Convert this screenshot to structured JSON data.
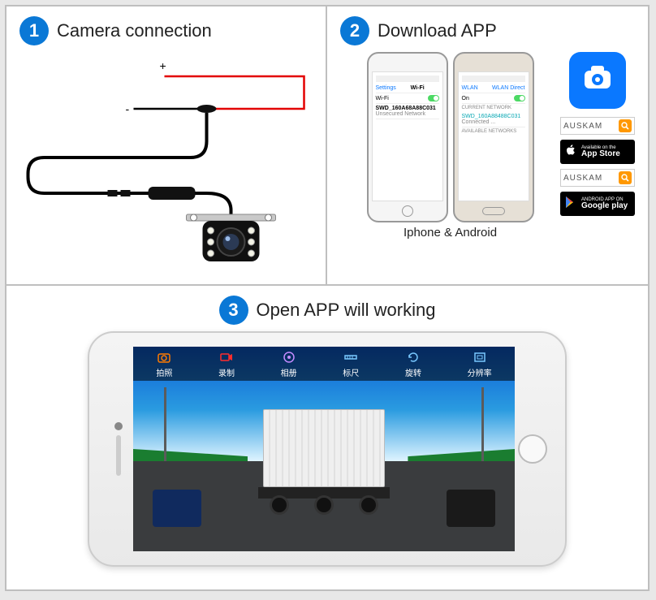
{
  "steps": {
    "one": {
      "num": "1",
      "title": "Camera connection"
    },
    "two": {
      "num": "2",
      "title": "Download APP",
      "caption": "Iphone & Android"
    },
    "three": {
      "num": "3",
      "title": "Open APP will working"
    }
  },
  "panel1": {
    "polarity_plus": "+",
    "polarity_minus": "-"
  },
  "panel2": {
    "phone1": {
      "nav_back": "Settings",
      "nav_title": "Wi-Fi",
      "wifi_label": "Wi-Fi",
      "network": "SWD_160A68A88C031",
      "network_sub": "Unsecured Network"
    },
    "phone2": {
      "nav_back": "WLAN",
      "nav_right": "WLAN Direct",
      "on_label": "On",
      "sect1": "CURRENT NETWORK",
      "network": "SWD_160A88488C031",
      "network_sub": "Connected ...",
      "sect2": "AVAILABLE NETWORKS"
    },
    "badges": {
      "search_text": "AUSKAM",
      "appstore_t1": "Available on the",
      "appstore_t2": "App Store",
      "play_t1": "ANDROID APP ON",
      "play_t2": "Google play"
    }
  },
  "panel3": {
    "toolbar": [
      {
        "label": "拍照"
      },
      {
        "label": "录制"
      },
      {
        "label": "相册"
      },
      {
        "label": "标尺"
      },
      {
        "label": "旋转"
      },
      {
        "label": "分辨率"
      }
    ]
  }
}
